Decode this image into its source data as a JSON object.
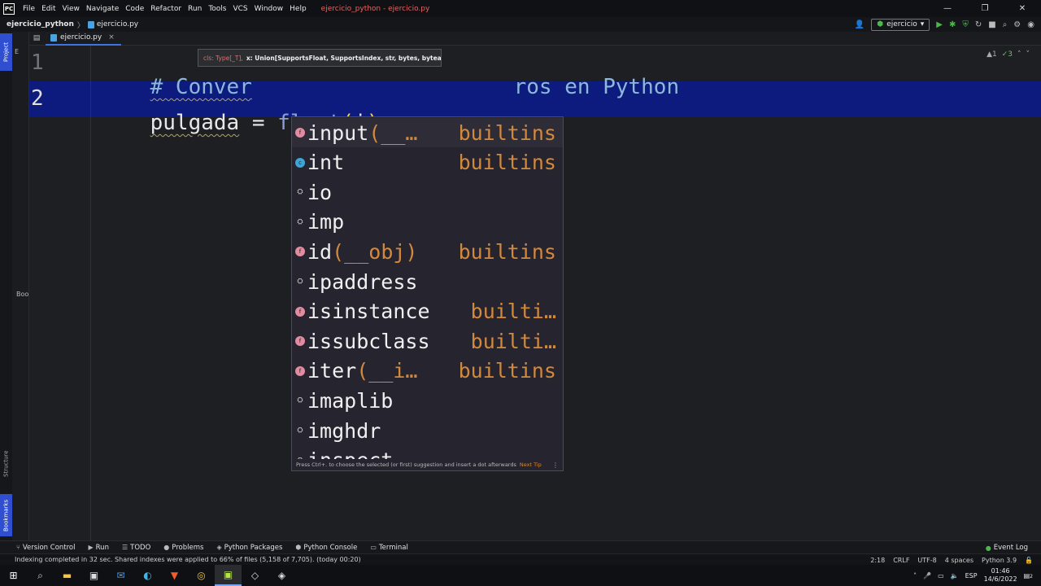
{
  "app": {
    "logo_text": "PC",
    "menu": [
      "File",
      "Edit",
      "View",
      "Navigate",
      "Code",
      "Refactor",
      "Run",
      "Tools",
      "VCS",
      "Window",
      "Help"
    ],
    "window_title": "ejercicio_python - ejercicio.py",
    "window_controls": {
      "minimize": "—",
      "restore": "❐",
      "close": "✕"
    }
  },
  "nav": {
    "project": "ejercicio_python",
    "file": "ejercicio.py",
    "run_config": "ejercicio"
  },
  "left_strip": {
    "project_tab": "Project",
    "structure_tab": "Structure",
    "bookmarks_tab": "Bookmarks"
  },
  "project_panel": {
    "fragment_top": "E",
    "fragment_mid": "Bool"
  },
  "tabs": [
    {
      "label": "ejercicio.py",
      "close": "×"
    }
  ],
  "editor": {
    "line_numbers": [
      "1",
      "2"
    ],
    "line1": {
      "comment_start": "# Conver",
      "comment_end": "ros en Python"
    },
    "line2": {
      "ident": "pulgada",
      "op": " = ",
      "func": "float",
      "open_paren": "(",
      "typed": "i",
      "close_paren": ")"
    },
    "inspections": {
      "warnings": "▲1",
      "ok": "✓3",
      "arrow_up": "˄",
      "arrow_down": "˅"
    }
  },
  "param_info": {
    "first_param": "cls: Type[_T],",
    "current_param": "x: Union[SupportsFloat, SupportsIndex, str, bytes, bytearray] = ..."
  },
  "completion": {
    "items": [
      {
        "kind": "func",
        "name": "input",
        "sig": "(__…",
        "type": "builtins"
      },
      {
        "kind": "cls",
        "name": "int",
        "sig": "",
        "type": "builtins"
      },
      {
        "kind": "mod",
        "name": "io",
        "sig": "",
        "type": ""
      },
      {
        "kind": "mod",
        "name": "imp",
        "sig": "",
        "type": ""
      },
      {
        "kind": "func",
        "name": "id",
        "sig": "(__obj)",
        "type": "builtins"
      },
      {
        "kind": "mod",
        "name": "ipaddress",
        "sig": "",
        "type": ""
      },
      {
        "kind": "func",
        "name": "isinstance",
        "sig": "",
        "type": "builti…"
      },
      {
        "kind": "func",
        "name": "issubclass",
        "sig": "",
        "type": "builti…"
      },
      {
        "kind": "func",
        "name": "iter",
        "sig": "(__i…",
        "type": "builtins"
      },
      {
        "kind": "mod",
        "name": "imaplib",
        "sig": "",
        "type": ""
      },
      {
        "kind": "mod",
        "name": "imghdr",
        "sig": "",
        "type": ""
      },
      {
        "kind": "mod",
        "name": "inspect",
        "sig": "",
        "type": ""
      }
    ],
    "footer": "Press Ctrl+. to choose the selected (or first) suggestion and insert a dot afterwards",
    "footer_tip": "Next Tip",
    "more_icon": "⋮"
  },
  "bottom_tools": [
    "Version Control",
    "Run",
    "TODO",
    "Problems",
    "Python Packages",
    "Python Console",
    "Terminal"
  ],
  "event_log": "Event Log",
  "status": {
    "message": "Indexing completed in 32 sec. Shared indexes were applied to 66% of files (5,158 of 7,705). (today 00:20)",
    "position": "2:18",
    "line_sep": "CRLF",
    "encoding": "UTF-8",
    "indent": "4 spaces",
    "interpreter": "Python 3.9"
  },
  "taskbar": {
    "lang": "ESP",
    "time": "01:46",
    "date": "14/6/2022",
    "notifications": "2"
  },
  "colors": {
    "current_line": "#0d1a7e",
    "completion_bg": "#26242e",
    "accent": "#3f73e0"
  }
}
